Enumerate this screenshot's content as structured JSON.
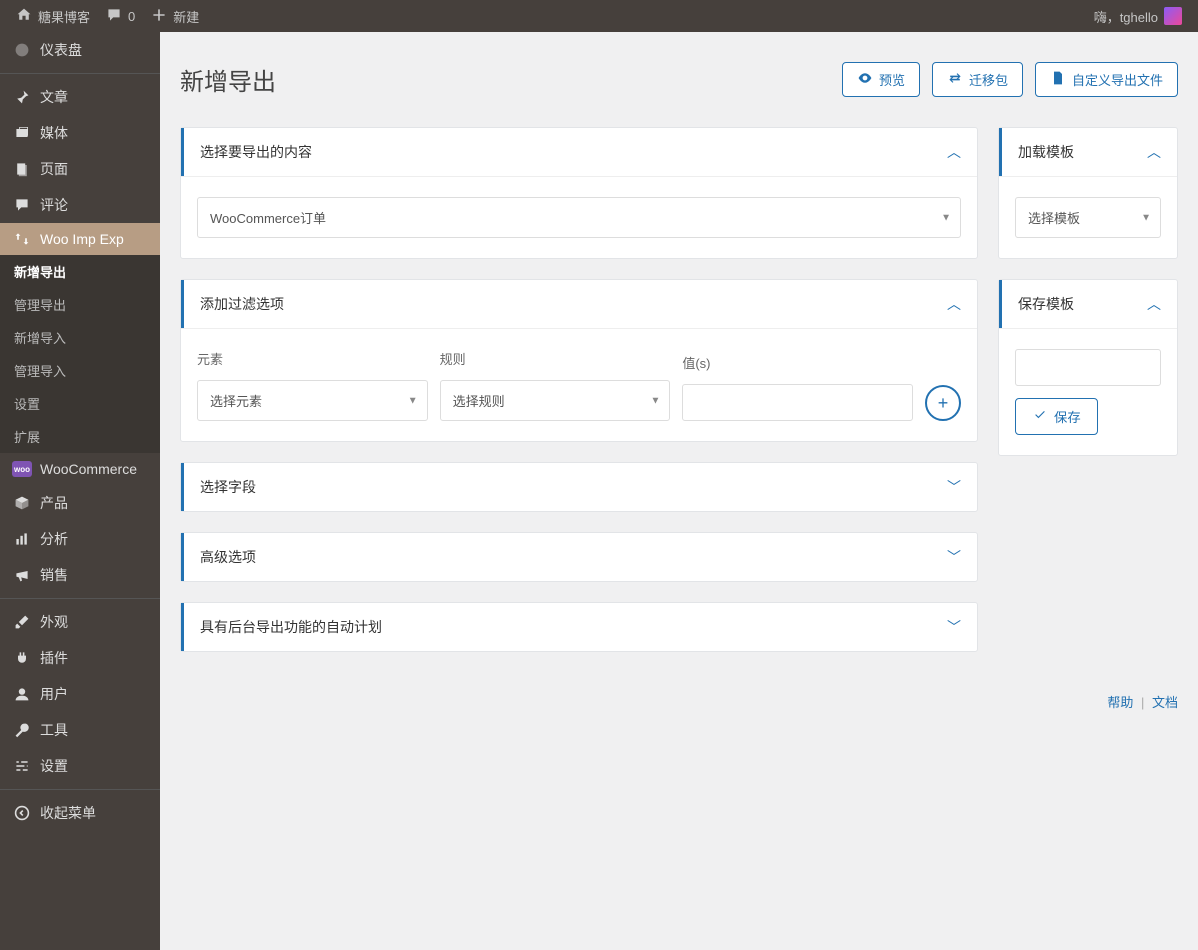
{
  "topbar": {
    "site_name": "糖果博客",
    "comments": "0",
    "new_label": "新建",
    "greeting": "嗨，tghello"
  },
  "sidebar": {
    "items": [
      {
        "key": "dashboard",
        "label": "仪表盘"
      },
      {
        "key": "posts",
        "label": "文章"
      },
      {
        "key": "media",
        "label": "媒体"
      },
      {
        "key": "pages",
        "label": "页面"
      },
      {
        "key": "comments",
        "label": "评论"
      },
      {
        "key": "wooimpexp",
        "label": "Woo Imp Exp"
      },
      {
        "key": "woocommerce",
        "label": "WooCommerce"
      },
      {
        "key": "products",
        "label": "产品"
      },
      {
        "key": "analytics",
        "label": "分析"
      },
      {
        "key": "marketing",
        "label": "销售"
      },
      {
        "key": "appearance",
        "label": "外观"
      },
      {
        "key": "plugins",
        "label": "插件"
      },
      {
        "key": "users",
        "label": "用户"
      },
      {
        "key": "tools",
        "label": "工具"
      },
      {
        "key": "settings",
        "label": "设置"
      },
      {
        "key": "collapse",
        "label": "收起菜单"
      }
    ],
    "submenu": [
      "新增导出",
      "管理导出",
      "新增导入",
      "管理导入",
      "设置",
      "扩展"
    ]
  },
  "page": {
    "title": "新增导出",
    "btn_preview": "预览",
    "btn_migrate": "迁移包",
    "btn_custom_file": "自定义导出文件"
  },
  "panels": {
    "select_content": {
      "title": "选择要导出的内容",
      "dropdown": "WooCommerce订单"
    },
    "filter": {
      "title": "添加过滤选项",
      "col_element": "元素",
      "col_rule": "规则",
      "col_value": "值(s)",
      "select_element": "选择元素",
      "select_rule": "选择规则"
    },
    "fields": {
      "title": "选择字段"
    },
    "advanced": {
      "title": "高级选项"
    },
    "auto_plan": {
      "title": "具有后台导出功能的自动计划"
    },
    "load_template": {
      "title": "加载模板",
      "select": "选择模板"
    },
    "save_template": {
      "title": "保存模板",
      "button": "保存"
    }
  },
  "footer": {
    "help": "帮助",
    "docs": "文档"
  }
}
